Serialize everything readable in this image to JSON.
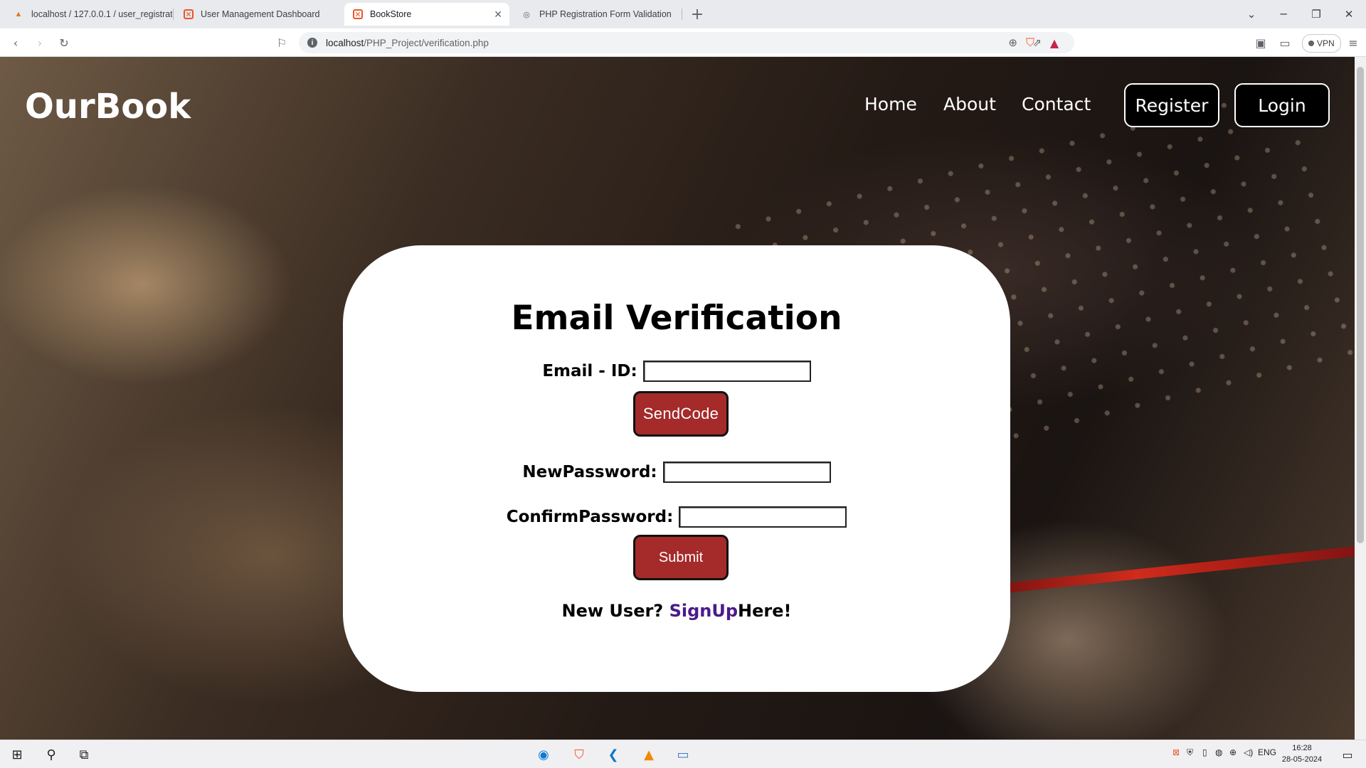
{
  "browser": {
    "tabs": [
      {
        "title": "localhost / 127.0.0.1 / user_registratio",
        "icon": "phpmyadmin-icon"
      },
      {
        "title": "User Management Dashboard",
        "icon": "xampp-icon"
      },
      {
        "title": "BookStore",
        "icon": "xampp-icon",
        "active": true
      },
      {
        "title": "PHP Registration Form Validation",
        "icon": "globe-icon"
      }
    ],
    "new_tab": "+",
    "address": {
      "host": "localhost",
      "path": "/PHP_Project/verification.php"
    },
    "vpn_label": "VPN"
  },
  "site": {
    "brand": "OurBook",
    "nav": {
      "home": "Home",
      "about": "About",
      "contact": "Contact"
    },
    "register": "Register",
    "login": "Login"
  },
  "form": {
    "title": "Email Verification",
    "email_label": "Email - ID:",
    "email_value": "",
    "send_code": "SendCode",
    "new_password_label": "NewPassword:",
    "new_password_value": "",
    "confirm_password_label": "ConfirmPassword:",
    "confirm_password_value": "",
    "submit": "Submit",
    "signup_prefix": "New User? ",
    "signup_link": "SignUp",
    "signup_suffix": "Here!"
  },
  "colors": {
    "button": "#a52a2a",
    "link": "#4b1a8c"
  },
  "taskbar": {
    "language": "ENG",
    "time": "16:28",
    "date": "28-05-2024"
  }
}
